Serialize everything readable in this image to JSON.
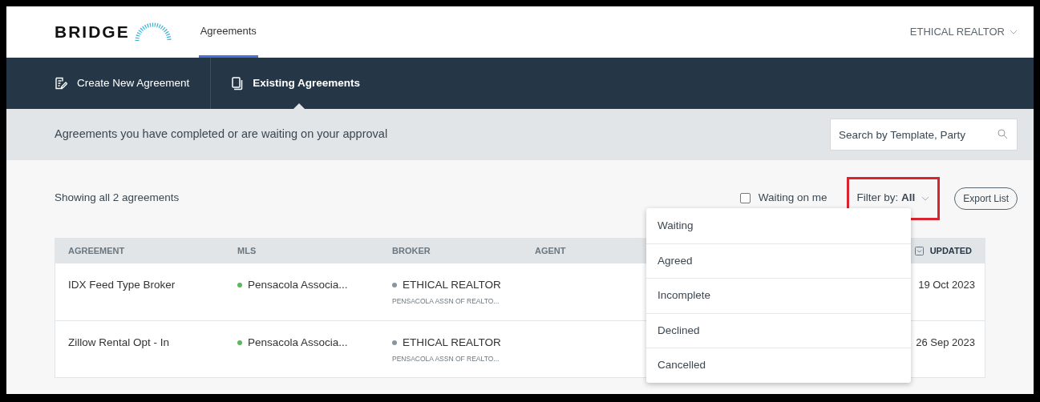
{
  "header": {
    "logo": "BRIDGE",
    "tabs": [
      {
        "label": "Agreements",
        "selected": true
      }
    ],
    "account": "ETHICAL REALTOR"
  },
  "nav": [
    {
      "label": "Create New Agreement",
      "selected": false
    },
    {
      "label": "Existing Agreements",
      "selected": true
    }
  ],
  "subheader": {
    "description": "Agreements you have completed or are waiting on your approval",
    "search": {
      "placeholder": "Search by Template, Party"
    }
  },
  "toolbar": {
    "count": "Showing all 2 agreements",
    "waiting_on_me": {
      "label": "Waiting on me",
      "checked": false
    },
    "filter": {
      "label": "Filter by:",
      "value": "All",
      "highlighted": true,
      "expanded": true,
      "options": [
        "Waiting",
        "Agreed",
        "Incomplete",
        "Declined",
        "Cancelled"
      ]
    },
    "export": "Export List"
  },
  "table": {
    "columns": [
      "AGREEMENT",
      "MLS",
      "BROKER",
      "AGENT",
      "UPDATED"
    ],
    "rows": [
      {
        "agreement": "IDX Feed Type Broker",
        "mls": "Pensacola Associa...",
        "mls_active": true,
        "broker": "ETHICAL REALTOR",
        "broker_active": false,
        "broker_sub": "PENSACOLA ASSN OF REALTO...",
        "updated": "19 Oct 2023"
      },
      {
        "agreement": "Zillow Rental Opt - In",
        "mls": "Pensacola Associa...",
        "mls_active": true,
        "broker": "ETHICAL REALTOR",
        "broker_active": false,
        "broker_sub": "PENSACOLA ASSN OF REALTO...",
        "updated": "26 Sep 2023"
      }
    ]
  }
}
